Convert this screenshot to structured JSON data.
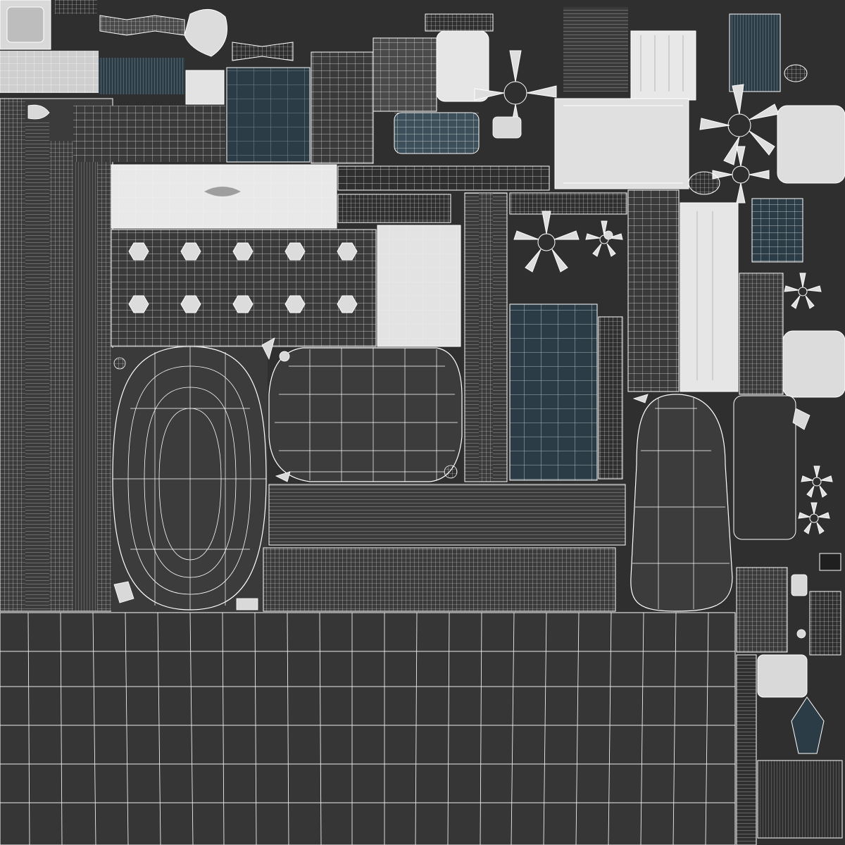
{
  "atlas": {
    "kind": "uv-texture-layout",
    "colors": {
      "background": "#2f2f2f",
      "island_dark": "#3a3a3a",
      "island_mid": "#6e6e6e",
      "island_light": "#e6e6e6",
      "island_teal": "#2b3c46",
      "wire": "#ffffff"
    },
    "icons": [
      "wheel-hub-icon",
      "star-rim-icon",
      "fan-blade-icon",
      "bolt-icon"
    ]
  }
}
